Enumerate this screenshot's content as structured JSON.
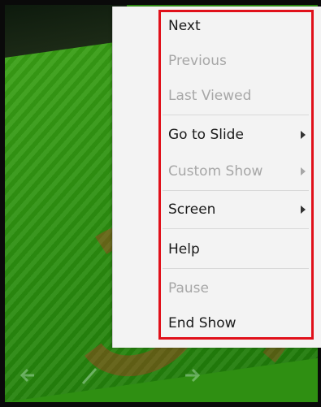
{
  "menu": {
    "items": [
      {
        "label": "Next",
        "enabled": true,
        "submenu": false
      },
      {
        "label": "Previous",
        "enabled": false,
        "submenu": false
      },
      {
        "label": "Last Viewed",
        "enabled": false,
        "submenu": false
      },
      {
        "label": "Go to Slide",
        "enabled": true,
        "submenu": true
      },
      {
        "label": "Custom Show",
        "enabled": false,
        "submenu": true
      },
      {
        "label": "Screen",
        "enabled": true,
        "submenu": true
      },
      {
        "label": "Help",
        "enabled": true,
        "submenu": false
      },
      {
        "label": "Pause",
        "enabled": false,
        "submenu": false
      },
      {
        "label": "End Show",
        "enabled": true,
        "submenu": false
      }
    ]
  },
  "toolbar": {
    "buttons": [
      {
        "name": "previous-slide",
        "icon": "arrow-left-icon"
      },
      {
        "name": "pen",
        "icon": "pen-icon"
      },
      {
        "name": "menu",
        "icon": "menu-icon"
      },
      {
        "name": "next-slide",
        "icon": "arrow-right-icon"
      }
    ]
  },
  "colors": {
    "highlight_red": "#e0101a",
    "menu_bg": "#f3f3f3",
    "slide_green": "#2f8f12",
    "disabled_text": "#a7a7a7"
  }
}
